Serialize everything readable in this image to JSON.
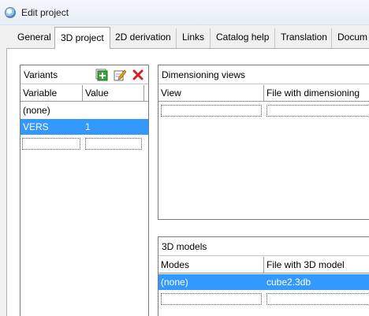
{
  "window": {
    "title": "Edit project"
  },
  "tabs": [
    {
      "label": "General",
      "active": false
    },
    {
      "label": "3D project",
      "active": true
    },
    {
      "label": "2D derivation",
      "active": false
    },
    {
      "label": "Links",
      "active": false
    },
    {
      "label": "Catalog help",
      "active": false
    },
    {
      "label": "Translation",
      "active": false
    },
    {
      "label": "Docum",
      "active": false
    }
  ],
  "variants": {
    "title": "Variants",
    "toolbar": {
      "add_icon": "add-variant-icon",
      "edit_icon": "edit-variant-icon",
      "delete_icon": "delete-variant-icon"
    },
    "columns": [
      "Variable",
      "Value"
    ],
    "rows": [
      {
        "variable": "(none)",
        "value": "",
        "selected": false
      },
      {
        "variable": "VERS",
        "value": "1",
        "selected": true
      }
    ]
  },
  "dimensioning_views": {
    "title": "Dimensioning views",
    "columns": [
      "View",
      "File with dimensioning"
    ]
  },
  "models_3d": {
    "title": "3D models",
    "columns": [
      "Modes",
      "File with 3D model"
    ],
    "rows": [
      {
        "mode": "(none)",
        "file": "cube2.3db",
        "selected": true
      }
    ]
  },
  "colors": {
    "selection": "#3399ff",
    "add_icon": "#2e9b2e",
    "delete_icon": "#d61f1f"
  }
}
